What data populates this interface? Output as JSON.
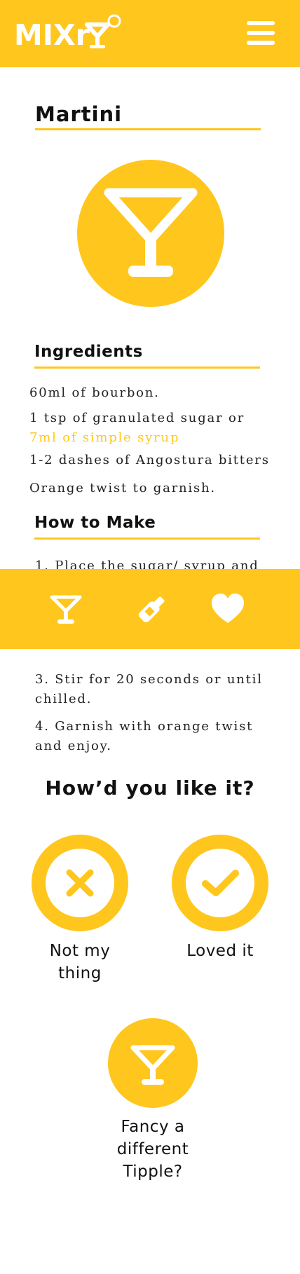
{
  "app": {
    "name": "MIXr",
    "brand_color": "#FFC61E"
  },
  "header": {
    "logo_text": "MIXr",
    "menu_icon": "hamburger-menu-icon"
  },
  "cocktail": {
    "name": "Martini",
    "image_icon": "martini-glass-icon"
  },
  "ingredients": {
    "heading": "Ingredients",
    "items": [
      {
        "text": "60ml of bourbon.",
        "highlight": ""
      },
      {
        "text": "1 tsp of granulated sugar or",
        "highlight": "7ml of simple syrup"
      },
      {
        "text": "1-2 dashes of Angostura bitters",
        "highlight": ""
      },
      {
        "text": "Orange twist to garnish.",
        "highlight": ""
      }
    ]
  },
  "method": {
    "heading": "How to Make",
    "steps": [
      "1. Place the sugar/ syrup and",
      "3. Stir for 20 seconds or until chilled.",
      "4. Garnish with orange twist and enjoy."
    ]
  },
  "bottom_nav": {
    "items": [
      {
        "icon": "martini-glass-icon",
        "name": "nav-cocktails"
      },
      {
        "icon": "bottle-icon",
        "name": "nav-spirits"
      },
      {
        "icon": "heart-icon",
        "name": "nav-favourites"
      }
    ]
  },
  "rating": {
    "question": "How’d you like it?",
    "dislike_label": "Not my thing",
    "like_label": "Loved it",
    "dislike_icon": "cross-icon",
    "like_icon": "checkmark-icon"
  },
  "suggest": {
    "label": "Fancy a different Tipple?",
    "icon": "martini-glass-icon"
  }
}
